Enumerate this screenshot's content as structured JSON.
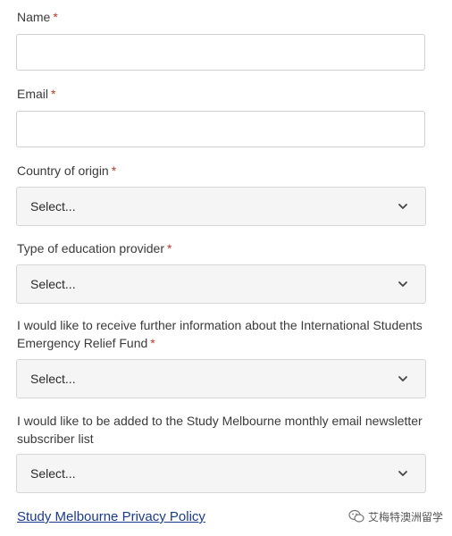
{
  "form": {
    "name": {
      "label": "Name",
      "required_mark": "*",
      "value": ""
    },
    "email": {
      "label": "Email",
      "required_mark": "*",
      "value": ""
    },
    "country": {
      "label": "Country of origin",
      "required_mark": "*",
      "selected": "Select..."
    },
    "provider": {
      "label": "Type of education provider",
      "required_mark": "*",
      "selected": "Select..."
    },
    "relief_fund": {
      "label": "I would like to receive further information about the International Students Emergency Relief Fund",
      "required_mark": "*",
      "selected": "Select..."
    },
    "newsletter": {
      "label": "I would like to be added to the Study Melbourne monthly email newsletter subscriber list",
      "selected": "Select..."
    },
    "privacy_link": "Study Melbourne Privacy Policy"
  },
  "watermark": {
    "text": "艾梅特澳洲留学",
    "icon": "wechat-icon"
  }
}
